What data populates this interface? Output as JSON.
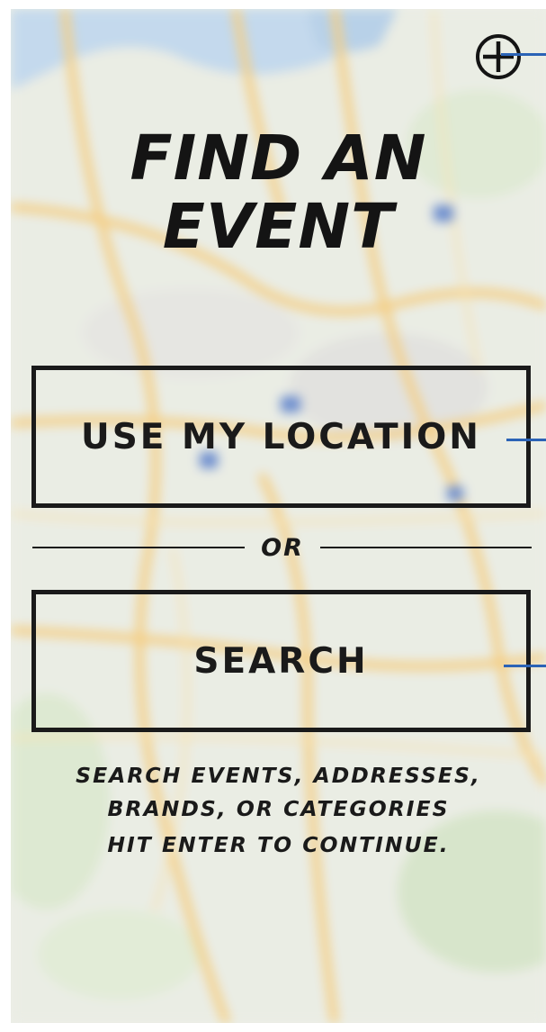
{
  "header": {
    "add_icon": "circle-plus-icon"
  },
  "title": {
    "line1": "FIND AN",
    "line2": "EVENT"
  },
  "actions": {
    "use_location_label": "USE MY LOCATION",
    "divider_label": "OR",
    "search_label": "SEARCH"
  },
  "hint": {
    "line1": "SEARCH EVENTS, ADDRESSES,",
    "line2": "BRANDS, OR CATEGORIES",
    "line3": "HIT ENTER TO CONTINUE."
  },
  "annotation_color": "#2b63b6",
  "background": "blurred-street-map"
}
